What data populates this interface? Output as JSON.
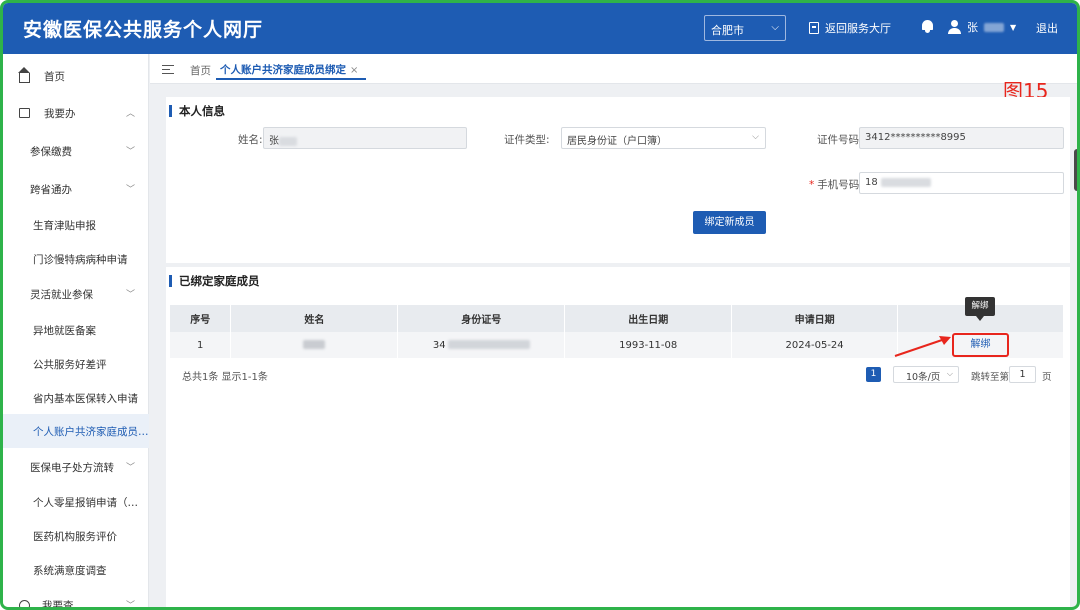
{
  "header": {
    "title": "安徽医保公共服务个人网厅",
    "city": "合肥市",
    "return_label": "返回服务大厅",
    "user_prefix": "张",
    "logout_label": "退出"
  },
  "sidebar": {
    "items": [
      {
        "label": "首页",
        "icon": "home-icon"
      },
      {
        "label": "我要办",
        "icon": "todo-icon"
      },
      {
        "label": "参保缴费"
      },
      {
        "label": "跨省通办"
      },
      {
        "label": "生育津贴申报"
      },
      {
        "label": "门诊慢特病病种申请"
      },
      {
        "label": "灵活就业参保"
      },
      {
        "label": "异地就医备案"
      },
      {
        "label": "公共服务好差评"
      },
      {
        "label": "省内基本医保转入申请"
      },
      {
        "label": "个人账户共济家庭成员绑定"
      },
      {
        "label": "医保电子处方流转"
      },
      {
        "label": "个人零星报销申请（电子..."
      },
      {
        "label": "医药机构服务评价"
      },
      {
        "label": "系统满意度调查"
      },
      {
        "label": "我要查",
        "icon": "search-circle-icon"
      }
    ]
  },
  "tabs": {
    "home": "首页",
    "active": "个人账户共济家庭成员绑定",
    "close": "×"
  },
  "annotation": "图15",
  "personal_info": {
    "section_title": "本人信息",
    "name_label": "姓名:",
    "name_value_prefix": "张",
    "id_type_label": "证件类型:",
    "id_type_value": "居民身份证（户口簿）",
    "id_number_label": "证件号码:",
    "id_number_value": "3412**********8995",
    "phone_label": "手机号码:",
    "phone_required": "*",
    "phone_value_prefix": "18",
    "bind_button": "绑定新成员"
  },
  "members": {
    "section_title": "已绑定家庭成员",
    "columns": [
      "序号",
      "姓名",
      "身份证号",
      "出生日期",
      "申请日期",
      ""
    ],
    "rows": [
      {
        "index": "1",
        "id_prefix": "34",
        "birth": "1993-11-08",
        "apply": "2024-05-24",
        "action": "解绑"
      }
    ],
    "tooltip": "解绑",
    "pagination": {
      "total": "总共1条 显示1-1条",
      "current_page": "1",
      "page_size": "10条/页",
      "jump_label": "跳转至第",
      "jump_value": "1",
      "page_suffix": "页"
    }
  },
  "colors": {
    "primary": "#1e5cb3",
    "accent_red": "#e8261d",
    "frame_green": "#2fb34a"
  }
}
